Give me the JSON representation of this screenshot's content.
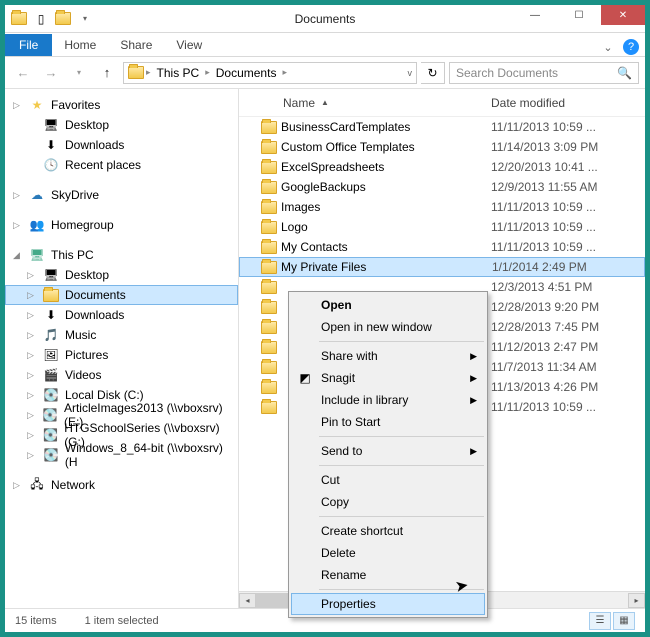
{
  "window": {
    "title": "Documents"
  },
  "ribbon": {
    "file": "File",
    "tabs": [
      "Home",
      "Share",
      "View"
    ]
  },
  "breadcrumb": {
    "parts": [
      "This PC",
      "Documents"
    ]
  },
  "search": {
    "placeholder": "Search Documents"
  },
  "columns": {
    "name": "Name",
    "date": "Date modified"
  },
  "nav": {
    "favorites": {
      "label": "Favorites",
      "items": [
        "Desktop",
        "Downloads",
        "Recent places"
      ]
    },
    "skydrive": {
      "label": "SkyDrive"
    },
    "homegroup": {
      "label": "Homegroup"
    },
    "thispc": {
      "label": "This PC",
      "items": [
        "Desktop",
        "Documents",
        "Downloads",
        "Music",
        "Pictures",
        "Videos",
        "Local Disk (C:)",
        "ArticleImages2013 (\\\\vboxsrv) (E:)",
        "HTGSchoolSeries (\\\\vboxsrv) (G:)",
        "Windows_8_64-bit (\\\\vboxsrv) (H"
      ],
      "selected_index": 1
    },
    "network": {
      "label": "Network"
    }
  },
  "files": [
    {
      "name": "BusinessCardTemplates",
      "date": "11/11/2013 10:59 ..."
    },
    {
      "name": "Custom Office Templates",
      "date": "11/14/2013 3:09 PM"
    },
    {
      "name": "ExcelSpreadsheets",
      "date": "12/20/2013 10:41 ..."
    },
    {
      "name": "GoogleBackups",
      "date": "12/9/2013 11:55 AM"
    },
    {
      "name": "Images",
      "date": "11/11/2013 10:59 ..."
    },
    {
      "name": "Logo",
      "date": "11/11/2013 10:59 ..."
    },
    {
      "name": "My Contacts",
      "date": "11/11/2013 10:59 ..."
    },
    {
      "name": "My Private Files",
      "date": "1/1/2014 2:49 PM"
    },
    {
      "name": "",
      "date": "12/3/2013 4:51 PM"
    },
    {
      "name": "",
      "date": "12/28/2013 9:20 PM"
    },
    {
      "name": "",
      "date": "12/28/2013 7:45 PM"
    },
    {
      "name": "",
      "date": "11/12/2013 2:47 PM"
    },
    {
      "name": "",
      "date": "11/7/2013 11:34 AM"
    },
    {
      "name": "",
      "date": "11/13/2013 4:26 PM"
    },
    {
      "name": "",
      "date": "11/11/2013 10:59 ..."
    }
  ],
  "selected_file_index": 7,
  "context_menu": {
    "open": "Open",
    "open_new": "Open in new window",
    "share_with": "Share with",
    "snagit": "Snagit",
    "include": "Include in library",
    "pin": "Pin to Start",
    "send_to": "Send to",
    "cut": "Cut",
    "copy": "Copy",
    "shortcut": "Create shortcut",
    "delete": "Delete",
    "rename": "Rename",
    "properties": "Properties"
  },
  "status": {
    "items": "15 items",
    "selected": "1 item selected"
  }
}
